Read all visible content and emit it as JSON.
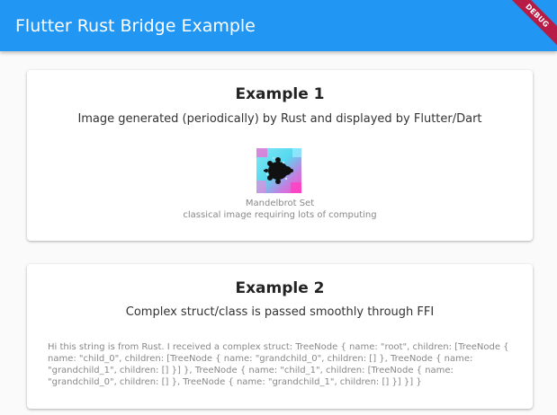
{
  "app": {
    "title": "Flutter Rust Bridge Example",
    "debug_banner": "DEBUG",
    "colors": {
      "appbar": "#2196f3",
      "banner": "#b71c47",
      "background": "#fafafa"
    }
  },
  "example1": {
    "title": "Example 1",
    "subtitle": "Image generated (periodically) by Rust and displayed by Flutter/Dart",
    "image_icon": "mandelbrot-image",
    "caption_title": "Mandelbrot Set",
    "caption_subtitle": "classical image requiring lots of computing"
  },
  "example2": {
    "title": "Example 2",
    "subtitle": "Complex struct/class is passed smoothly through FFI",
    "rust_text": "Hi this string is from Rust. I received a complex struct: TreeNode { name: \"root\", children: [TreeNode { name: \"child_0\", children: [TreeNode { name: \"grandchild_0\", children: [] }, TreeNode { name: \"grandchild_1\", children: [] }] }, TreeNode { name: \"child_1\", children: [TreeNode { name: \"grandchild_0\", children: [] }, TreeNode { name: \"grandchild_1\", children: [] }] }] }"
  }
}
